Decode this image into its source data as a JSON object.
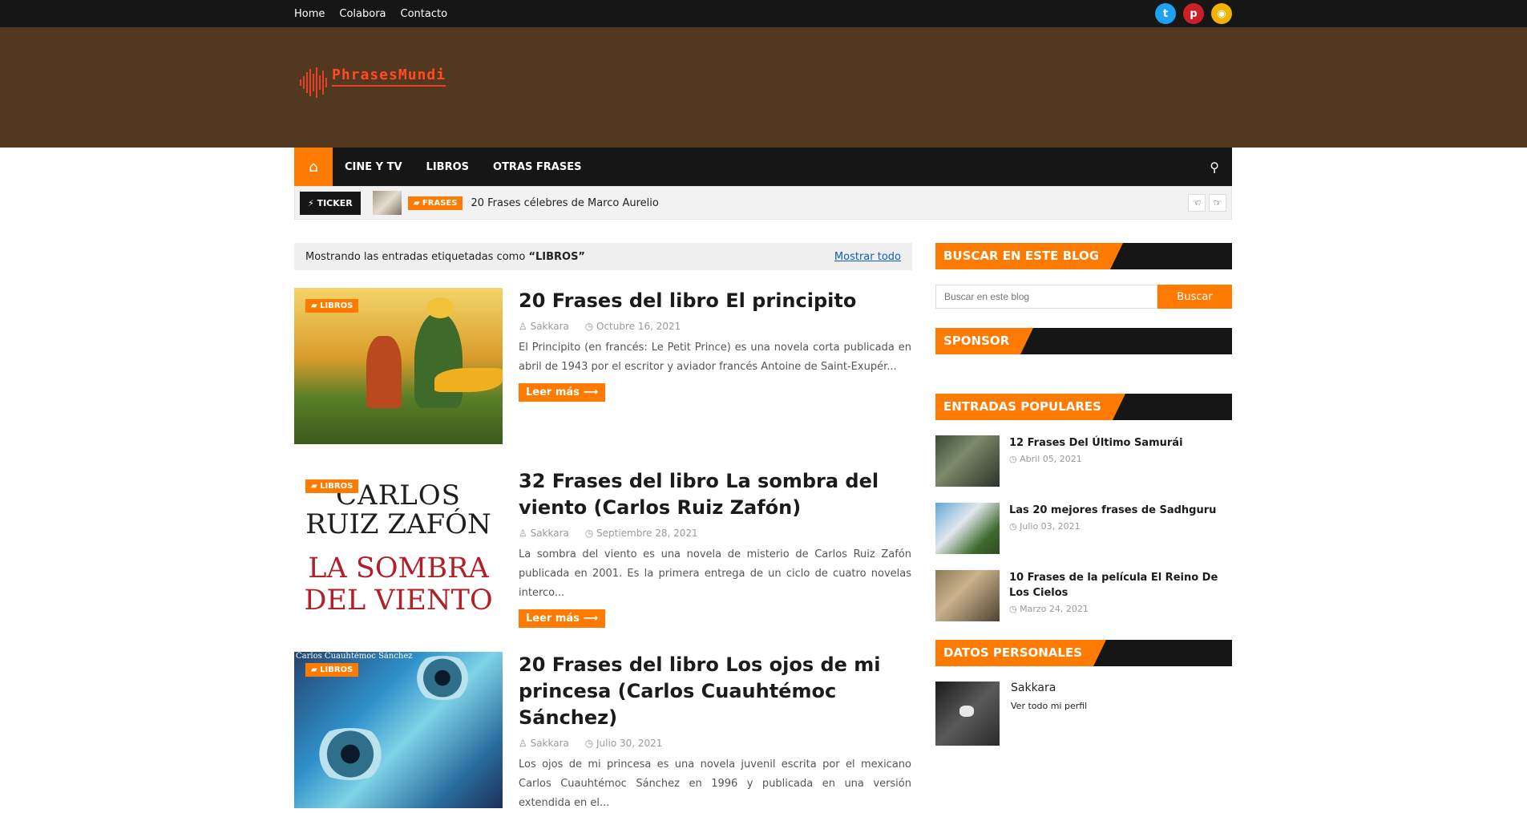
{
  "topbar": {
    "links": [
      "Home",
      "Colabora",
      "Contacto"
    ],
    "social": [
      "twitter-icon",
      "pinterest-icon",
      "rss-icon"
    ]
  },
  "header": {
    "logo_text": "PhrasesMundi"
  },
  "nav": {
    "items": [
      "CINE Y TV",
      "LIBROS",
      "OTRAS FRASES"
    ]
  },
  "ticker": {
    "label": "TICKER",
    "category": "FRASES",
    "headline": "20 Frases célebres de Marco Aurelio"
  },
  "tagbar": {
    "prefix": "Mostrando las entradas etiquetadas como",
    "tag": "“LIBROS”",
    "show_all": "Mostrar todo"
  },
  "posts": [
    {
      "badge": "LIBROS",
      "title": "20 Frases del libro El principito",
      "author": "Sakkara",
      "date": "Octubre 16, 2021",
      "excerpt": "El Principito (en francés: Le Petit Prince) es una novela corta publicada en abril de 1943 por el escritor y aviador francés Antoine de Saint-Exupér...",
      "more": "Leer más"
    },
    {
      "badge": "LIBROS",
      "title": "32 Frases del libro La sombra del viento (Carlos Ruiz Zafón)",
      "author": "Sakkara",
      "date": "Septiembre 28, 2021",
      "excerpt": "La sombra del viento es una novela de misterio de Carlos Ruiz Zafón publicada en 2001. Es la primera entrega de un ciclo de cuatro novelas interco...",
      "more": "Leer más",
      "cover": [
        "CARLOS",
        "RUIZ ZAFÓN",
        "LA SOMBRA",
        "DEL VIENTO"
      ]
    },
    {
      "badge": "LIBROS",
      "title": "20 Frases del libro Los ojos de mi princesa (Carlos Cuauhtémoc Sánchez)",
      "author": "Sakkara",
      "date": "Julio 30, 2021",
      "excerpt": "Los ojos de mi princesa es una novela juvenil escrita por el mexicano Carlos Cuauhtémoc Sánchez en 1996  y publicada en una versión extendida en el...",
      "more": "Leer más",
      "cover_author": "Carlos Cuauhtémoc Sánchez"
    }
  ],
  "sidebar": {
    "search_title": "BUSCAR EN ESTE BLOG",
    "search_placeholder": "Buscar en este blog",
    "search_button": "Buscar",
    "sponsor_title": "SPONSOR",
    "popular_title": "ENTRADAS POPULARES",
    "popular": [
      {
        "title": "12 Frases Del Último Samurái",
        "date": "Abril 05, 2021"
      },
      {
        "title": "Las 20 mejores frases de Sadhguru",
        "date": "Julio 03, 2021"
      },
      {
        "title": "10 Frases de la película El Reino De Los Cielos",
        "date": "Marzo 24, 2021"
      }
    ],
    "profile_title": "DATOS PERSONALES",
    "profile_name": "Sakkara",
    "profile_link": "Ver todo mi perfil"
  },
  "colors": {
    "accent": "#ff7a00",
    "header_bg": "#533820",
    "dark": "#161616"
  }
}
